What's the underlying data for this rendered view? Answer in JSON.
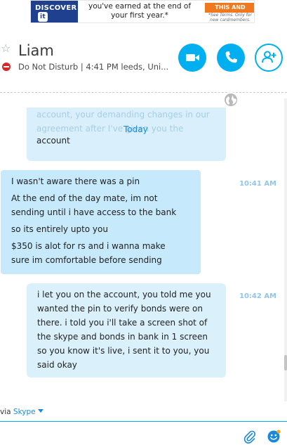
{
  "ad": {
    "brand": "DISCOVER",
    "brand_suffix": "it",
    "message": "you've earned at the end of your first year.*",
    "cta": "THIS AND MORE ›",
    "terms": "*See Terms. Only for new cardmembers."
  },
  "header": {
    "contact_name": "Liam",
    "status": "Do Not Disturb",
    "status_detail": "4:41 PM leeds, Uni...",
    "icons": {
      "favorite": "star-icon",
      "status": "do-not-disturb-icon",
      "video": "video-camera-icon",
      "call": "phone-icon",
      "add": "add-contact-icon",
      "globe": "globe-icon"
    },
    "accent_color": "#00aff0",
    "dnd_color": "#d62a2a"
  },
  "conversation": {
    "date_divider": "Today",
    "previous_message_faded": "account, your demanding changes in our agreement after I've given you the",
    "previous_message_last_line": "account",
    "incoming": {
      "time": "10:41 AM",
      "lines": [
        "I wasn't aware there was a pin",
        "At the end of the day mate, im not",
        "sending until i have access to the bank",
        "so its entirely upto you",
        "$350 is alot for rs and i wanna make",
        "sure im comfortable before sending"
      ]
    },
    "outgoing": {
      "time": "10:42 AM",
      "text": "i let you on the account, you told me you wanted the pin to verify bonds were on there. i told you i'll take a screen shot of the skype and bonds in bank in 1 screen so you know it's live, i sent it to you, you said okay"
    }
  },
  "compose": {
    "via_prefix": "via",
    "via_service": "Skype",
    "icons": {
      "attach": "paperclip-icon",
      "emoji": "emoticon-icon"
    }
  }
}
